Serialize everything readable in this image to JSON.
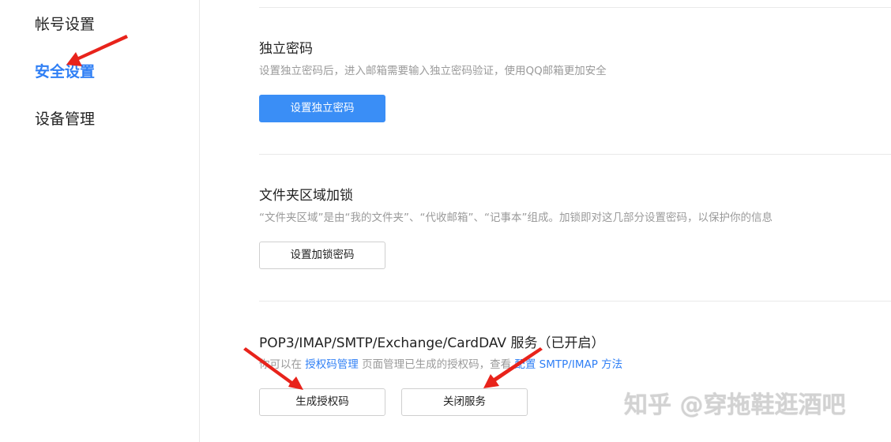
{
  "sidebar": {
    "items": [
      {
        "label": "帐号设置",
        "active": false
      },
      {
        "label": "安全设置",
        "active": true
      },
      {
        "label": "设备管理",
        "active": false
      }
    ]
  },
  "sections": {
    "independent_password": {
      "title": "独立密码",
      "desc": "设置独立密码后，进入邮箱需要输入独立密码验证，使用QQ邮箱更加安全",
      "button": "设置独立密码"
    },
    "folder_lock": {
      "title": "文件夹区域加锁",
      "desc": "“文件夹区域”是由“我的文件夹”、“代收邮箱”、“记事本”组成。加锁即对这几部分设置密码，以保护你的信息",
      "button": "设置加锁密码"
    },
    "pop3_service": {
      "title": "POP3/IMAP/SMTP/Exchange/CardDAV 服务（已开启）",
      "desc_part1": "你可以在",
      "desc_link1": "授权码管理",
      "desc_part2": "页面管理已生成的授权码，查看",
      "desc_link2": "配置 SMTP/IMAP 方法",
      "button_generate": "生成授权码",
      "button_close": "关闭服务"
    }
  },
  "watermark": "知乎 @穿拖鞋逛酒吧",
  "colors": {
    "accent": "#2f7ff5",
    "primary_button": "#3a8ef6",
    "annotation_arrow": "#e8231b"
  }
}
